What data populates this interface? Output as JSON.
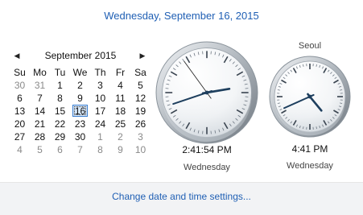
{
  "header": {
    "date": "Wednesday, September 16, 2015"
  },
  "calendar": {
    "month_label": "September 2015",
    "prev_icon": "triangle-left-icon",
    "next_icon": "triangle-right-icon",
    "weekdays": [
      "Su",
      "Mo",
      "Tu",
      "We",
      "Th",
      "Fr",
      "Sa"
    ],
    "weeks": [
      [
        "30",
        "31",
        "1",
        "2",
        "3",
        "4",
        "5"
      ],
      [
        "6",
        "7",
        "8",
        "9",
        "10",
        "11",
        "12"
      ],
      [
        "13",
        "14",
        "15",
        "16",
        "17",
        "18",
        "19"
      ],
      [
        "20",
        "21",
        "22",
        "23",
        "24",
        "25",
        "26"
      ],
      [
        "27",
        "28",
        "29",
        "30",
        "1",
        "2",
        "3"
      ],
      [
        "4",
        "5",
        "6",
        "7",
        "8",
        "9",
        "10"
      ]
    ],
    "selected_day": "16"
  },
  "clocks": {
    "local": {
      "time": "2:41:54 PM",
      "day": "Wednesday",
      "hour": 14,
      "minute": 41,
      "second": 54
    },
    "seoul": {
      "city": "Seoul",
      "time": "4:41 PM",
      "day": "Wednesday",
      "hour": 16,
      "minute": 41
    }
  },
  "footer": {
    "link": "Change date and time settings..."
  },
  "colors": {
    "link": "#1f5fb4",
    "hand": "#1e3f5e",
    "accent": "#3c7fd0"
  }
}
